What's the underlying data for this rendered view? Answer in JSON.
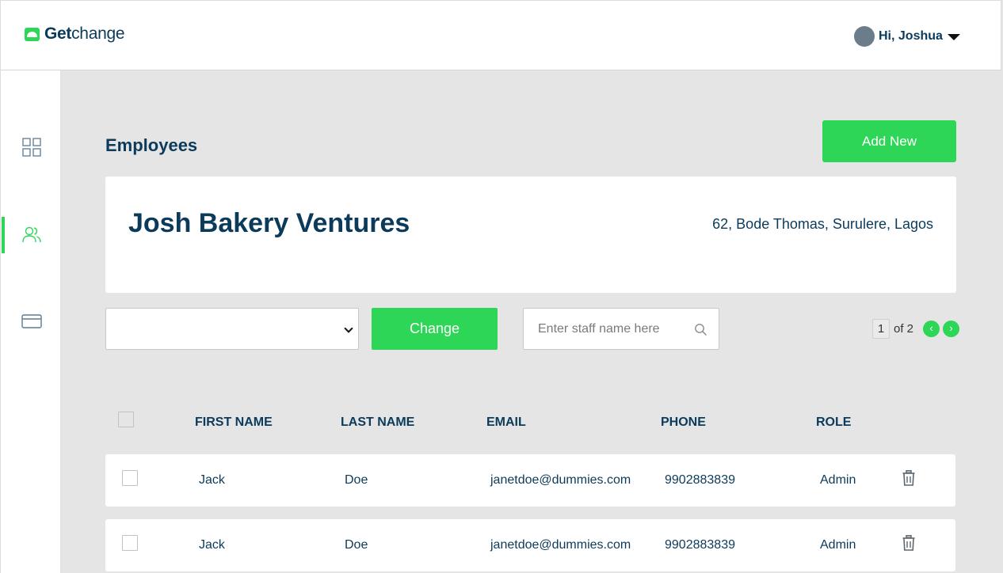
{
  "brand": {
    "name_bold": "Get",
    "name_light": "change"
  },
  "header": {
    "greeting": "Hi, Joshua"
  },
  "sidebar": {
    "items": [
      {
        "icon": "grid-icon",
        "active": false
      },
      {
        "icon": "users-icon",
        "active": true
      },
      {
        "icon": "card-icon",
        "active": false
      }
    ]
  },
  "page": {
    "title": "Employees",
    "add_button": "Add New"
  },
  "company": {
    "name": "Josh Bakery Ventures",
    "address": "62, Bode Thomas, Surulere, Lagos"
  },
  "filters": {
    "select_value": "",
    "change_button": "Change",
    "search_placeholder": "Enter staff name here"
  },
  "pagination": {
    "current": "1",
    "of_label": "of 2",
    "prev": "‹",
    "next": "›"
  },
  "table": {
    "columns": [
      "FIRST NAME",
      "LAST NAME",
      "EMAIL",
      "PHONE",
      "ROLE"
    ],
    "rows": [
      {
        "first": "Jack",
        "last": "Doe",
        "email": "janetdoe@dummies.com",
        "phone": "9902883839",
        "role": "Admin"
      },
      {
        "first": "Jack",
        "last": "Doe",
        "email": "janetdoe@dummies.com",
        "phone": "9902883839",
        "role": "Admin"
      }
    ]
  },
  "colors": {
    "accent": "#2ed657",
    "text": "#0b3a5b",
    "background": "#e5e5e5"
  }
}
